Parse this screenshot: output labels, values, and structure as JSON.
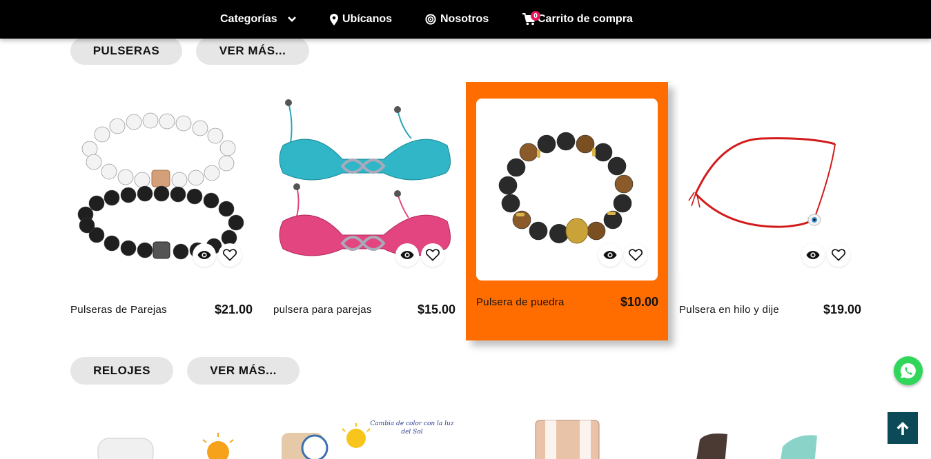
{
  "nav": {
    "categories": "Categorías",
    "location": "Ubícanos",
    "about": "Nosotros",
    "cart": "Carrito de compra",
    "cart_count": "0"
  },
  "sections": {
    "bracelets": {
      "title": "PULSERAS",
      "more": "VER MÁS..."
    },
    "watches": {
      "title": "RELOJES",
      "more": "VER MÁS..."
    }
  },
  "products": [
    {
      "name": "Pulseras de Parejas",
      "price": "$21.00"
    },
    {
      "name": "pulsera para parejas",
      "price": "$15.00"
    },
    {
      "name": "Pulsera de puedra",
      "price": "$10.00"
    },
    {
      "name": "Pulsera en hilo y dije",
      "price": "$19.00"
    }
  ],
  "watch_banner_text": "Cambia de color con la luz del Sol",
  "colors": {
    "accent": "#ff6d00",
    "nav_bg": "#000000",
    "badge": "#e8175d",
    "whatsapp": "#2fd65a",
    "to_top": "#0d4a57"
  }
}
